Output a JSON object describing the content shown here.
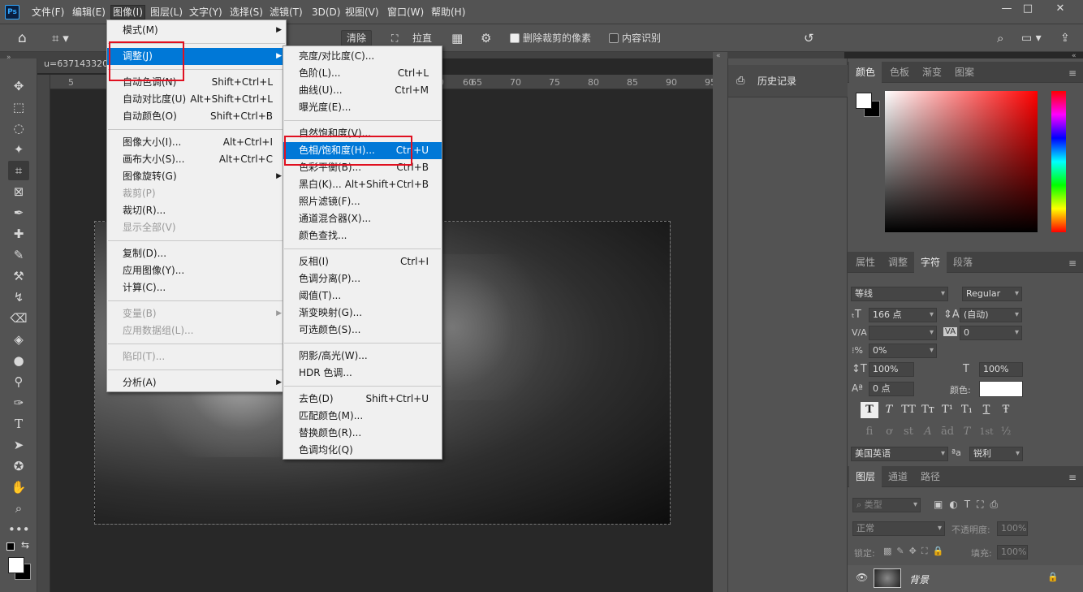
{
  "menubar": {
    "logo": "Ps",
    "items": [
      "文件(F)",
      "编辑(E)",
      "图像(I)",
      "图层(L)",
      "文字(Y)",
      "选择(S)",
      "滤镜(T)",
      "3D(D)",
      "视图(V)",
      "窗口(W)",
      "帮助(H)"
    ],
    "window_buttons": [
      "—",
      "□",
      "✕"
    ]
  },
  "options": {
    "clear": "清除",
    "straighten": "拉直",
    "delete_cropped": "删除裁剪的像素",
    "content_aware": "内容识别"
  },
  "document": {
    "tab_title": "u=637143320,",
    "ruler_ticks": [
      "5",
      "0",
      "60",
      "65",
      "70",
      "75",
      "80",
      "85",
      "90",
      "95",
      "10"
    ]
  },
  "image_menu": {
    "items": [
      {
        "label": "模式(M)",
        "shortcut": "",
        "submenu": true
      },
      {
        "sep": true
      },
      {
        "label": "调整(J)",
        "shortcut": "",
        "submenu": true,
        "hi": true
      },
      {
        "sep": true
      },
      {
        "label": "自动色调(N)",
        "shortcut": "Shift+Ctrl+L"
      },
      {
        "label": "自动对比度(U)",
        "shortcut": "Alt+Shift+Ctrl+L"
      },
      {
        "label": "自动颜色(O)",
        "shortcut": "Shift+Ctrl+B"
      },
      {
        "sep": true
      },
      {
        "label": "图像大小(I)...",
        "shortcut": "Alt+Ctrl+I"
      },
      {
        "label": "画布大小(S)...",
        "shortcut": "Alt+Ctrl+C"
      },
      {
        "label": "图像旋转(G)",
        "shortcut": "",
        "submenu": true
      },
      {
        "label": "裁剪(P)",
        "shortcut": "",
        "dis": true
      },
      {
        "label": "裁切(R)...",
        "shortcut": ""
      },
      {
        "label": "显示全部(V)",
        "shortcut": "",
        "dis": true
      },
      {
        "sep": true
      },
      {
        "label": "复制(D)...",
        "shortcut": ""
      },
      {
        "label": "应用图像(Y)...",
        "shortcut": ""
      },
      {
        "label": "计算(C)...",
        "shortcut": ""
      },
      {
        "sep": true
      },
      {
        "label": "变量(B)",
        "shortcut": "",
        "submenu": true,
        "dis": true
      },
      {
        "label": "应用数据组(L)...",
        "shortcut": "",
        "dis": true
      },
      {
        "sep": true
      },
      {
        "label": "陷印(T)...",
        "shortcut": "",
        "dis": true
      },
      {
        "sep": true
      },
      {
        "label": "分析(A)",
        "shortcut": "",
        "submenu": true
      }
    ]
  },
  "adjust_menu": {
    "items": [
      {
        "label": "亮度/对比度(C)...",
        "shortcut": ""
      },
      {
        "label": "色阶(L)...",
        "shortcut": "Ctrl+L"
      },
      {
        "label": "曲线(U)...",
        "shortcut": "Ctrl+M"
      },
      {
        "label": "曝光度(E)...",
        "shortcut": ""
      },
      {
        "sep": true
      },
      {
        "label": "自然饱和度(V)...",
        "shortcut": ""
      },
      {
        "label": "色相/饱和度(H)...",
        "shortcut": "Ctrl+U",
        "hi": true
      },
      {
        "label": "色彩平衡(B)...",
        "shortcut": "Ctrl+B"
      },
      {
        "label": "黑白(K)...",
        "shortcut": "Alt+Shift+Ctrl+B"
      },
      {
        "label": "照片滤镜(F)...",
        "shortcut": ""
      },
      {
        "label": "通道混合器(X)...",
        "shortcut": ""
      },
      {
        "label": "颜色查找...",
        "shortcut": ""
      },
      {
        "sep": true
      },
      {
        "label": "反相(I)",
        "shortcut": "Ctrl+I"
      },
      {
        "label": "色调分离(P)...",
        "shortcut": ""
      },
      {
        "label": "阈值(T)...",
        "shortcut": ""
      },
      {
        "label": "渐变映射(G)...",
        "shortcut": ""
      },
      {
        "label": "可选颜色(S)...",
        "shortcut": ""
      },
      {
        "sep": true
      },
      {
        "label": "阴影/高光(W)...",
        "shortcut": ""
      },
      {
        "label": "HDR 色调...",
        "shortcut": ""
      },
      {
        "sep": true
      },
      {
        "label": "去色(D)",
        "shortcut": "Shift+Ctrl+U"
      },
      {
        "label": "匹配颜色(M)...",
        "shortcut": ""
      },
      {
        "label": "替换颜色(R)...",
        "shortcut": ""
      },
      {
        "label": "色调均化(Q)",
        "shortcut": ""
      }
    ]
  },
  "history": {
    "title": "历史记录"
  },
  "color_panel": {
    "tabs": [
      "颜色",
      "色板",
      "渐变",
      "图案"
    ]
  },
  "char_panel": {
    "tabs": [
      "属性",
      "调整",
      "字符",
      "段落"
    ],
    "font": "等线",
    "style": "Regular",
    "size": "166 点",
    "leading": "(自动)",
    "kerning": "",
    "tracking": "0",
    "scale_pct": "0%",
    "vscale": "100%",
    "hscale": "100%",
    "baseline": "0 点",
    "color_label": "颜色:",
    "language": "美国英语",
    "aa_label": "ªa",
    "aa": "锐利",
    "style_btns": [
      "T",
      "T",
      "TT",
      "Tт",
      "T¹",
      "T₁",
      "T",
      "Ŧ"
    ],
    "ot_btns": [
      "fi",
      "ơ",
      "st",
      "A",
      "ād",
      "T",
      "1st",
      "½"
    ]
  },
  "layers_panel": {
    "tabs": [
      "图层",
      "通道",
      "路径"
    ],
    "filter": "类型",
    "blend": "正常",
    "opacity_label": "不透明度:",
    "opacity": "100%",
    "lock_label": "锁定:",
    "fill_label": "填充:",
    "fill": "100%",
    "layer_name": "背景"
  },
  "colors": {
    "highlight": "#0078d7",
    "redbox": "#e01020"
  }
}
